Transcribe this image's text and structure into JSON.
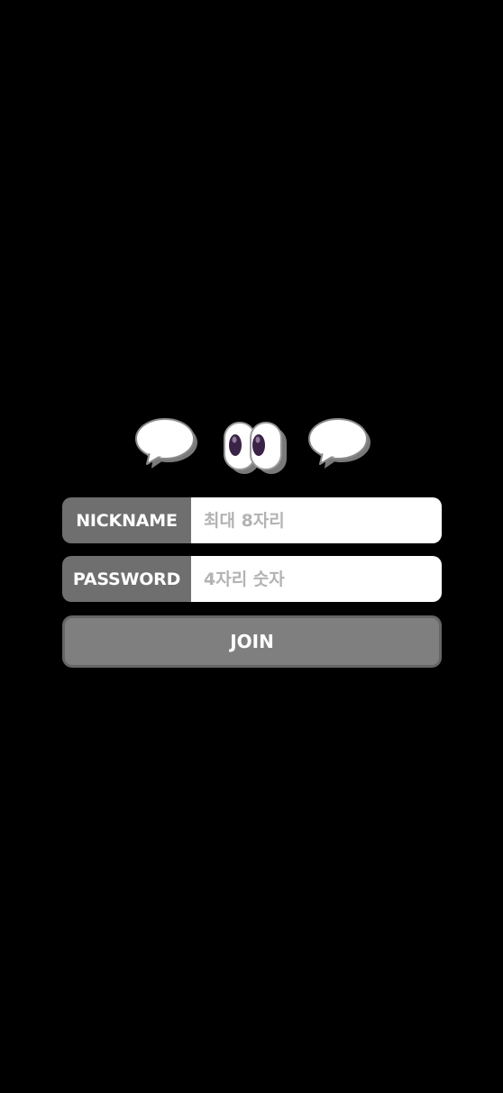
{
  "colors": {
    "background": "#000000",
    "label_bg": "#6f6f6f",
    "input_bg": "#ffffff",
    "placeholder": "#b3b3b3",
    "button_bg": "#7f7f7f",
    "button_border": "#656565",
    "pupil": "#3b2347"
  },
  "logo": {
    "icons": [
      "speech-bubble-icon",
      "eyes-icon",
      "speech-bubble-icon"
    ]
  },
  "form": {
    "nickname": {
      "label": "NICKNAME",
      "placeholder": "최대 8자리",
      "value": ""
    },
    "password": {
      "label": "PASSWORD",
      "placeholder": "4자리 숫자",
      "value": ""
    },
    "join_label": "JOIN"
  }
}
